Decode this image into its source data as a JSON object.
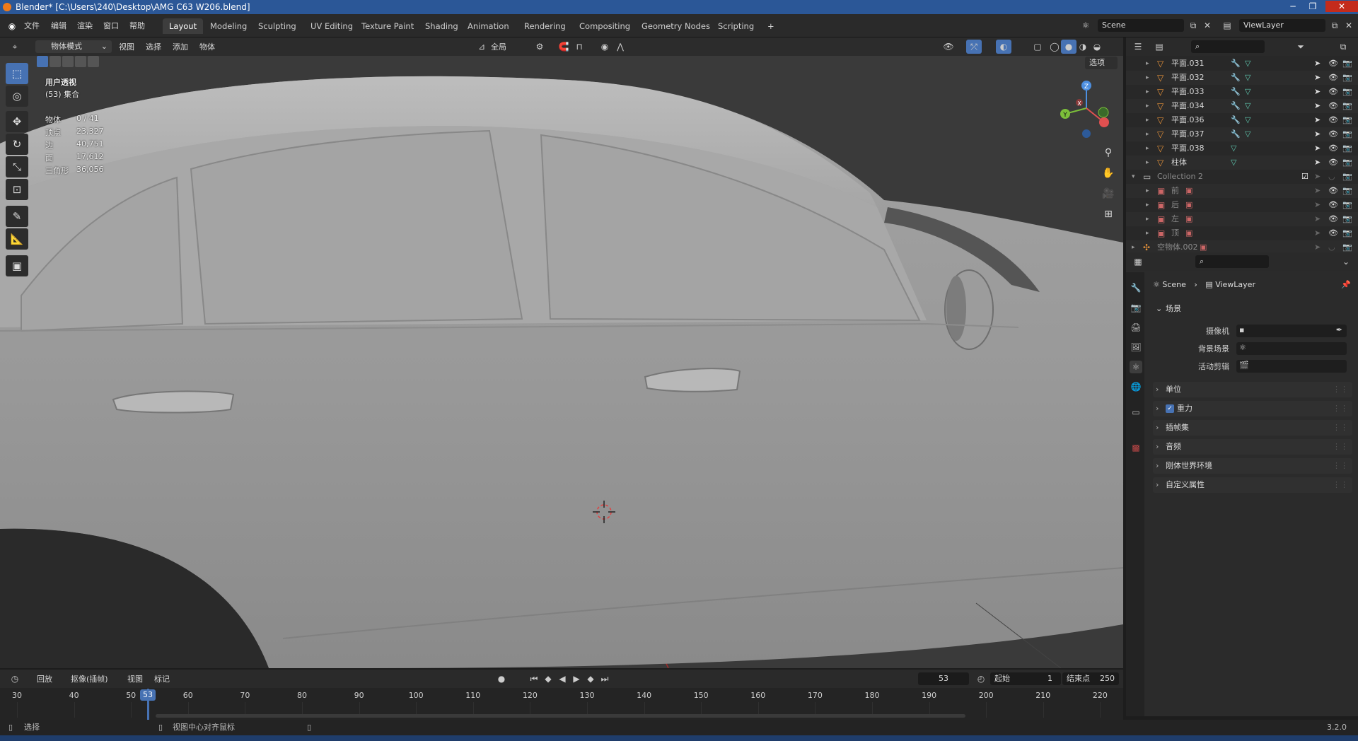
{
  "window": {
    "title": "Blender* [C:\\Users\\240\\Desktop\\AMG C63 W206.blend]",
    "minimize": "─",
    "maximize": "❐",
    "close": "✕"
  },
  "menu": {
    "file": "文件",
    "edit": "编辑",
    "render": "渲染",
    "window": "窗口",
    "help": "帮助"
  },
  "workspaces": [
    {
      "label": "Layout",
      "active": true
    },
    {
      "label": "Modeling"
    },
    {
      "label": "Sculpting"
    },
    {
      "label": "UV Editing"
    },
    {
      "label": "Texture Paint"
    },
    {
      "label": "Shading"
    },
    {
      "label": "Animation"
    },
    {
      "label": "Rendering"
    },
    {
      "label": "Compositing"
    },
    {
      "label": "Geometry Nodes"
    },
    {
      "label": "Scripting"
    },
    {
      "label": "+"
    }
  ],
  "scene": {
    "name": "Scene",
    "view_layer": "ViewLayer"
  },
  "viewport_header": {
    "mode": "物体模式",
    "view": "视图",
    "select": "选择",
    "add": "添加",
    "object": "物体",
    "transform_orientation": "全局",
    "options": "选项"
  },
  "overlay_text": {
    "view_name": "用户透视",
    "collection": "(53) 集合"
  },
  "stats": [
    {
      "label": "物体",
      "value": "0 / 41"
    },
    {
      "label": "顶点",
      "value": "23,327"
    },
    {
      "label": "边",
      "value": "40,751"
    },
    {
      "label": "面",
      "value": "17,612"
    },
    {
      "label": "三角形",
      "value": "36,056"
    }
  ],
  "gizmo": {
    "x": "X",
    "y": "Y",
    "z": "Z"
  },
  "outliner": {
    "rows": [
      {
        "name": "平面.031",
        "type": "mesh",
        "modifier": true,
        "indent": 1
      },
      {
        "name": "平面.032",
        "type": "mesh",
        "modifier": true,
        "indent": 1
      },
      {
        "name": "平面.033",
        "type": "mesh",
        "modifier": true,
        "indent": 1
      },
      {
        "name": "平面.034",
        "type": "mesh",
        "modifier": true,
        "indent": 1
      },
      {
        "name": "平面.036",
        "type": "mesh",
        "modifier": true,
        "indent": 1
      },
      {
        "name": "平面.037",
        "type": "mesh",
        "modifier": true,
        "indent": 1
      },
      {
        "name": "平面.038",
        "type": "mesh",
        "modifier": false,
        "indent": 1
      },
      {
        "name": "柱体",
        "type": "mesh",
        "modifier": false,
        "indent": 1
      },
      {
        "name": "Collection 2",
        "type": "collection",
        "indent": 0
      },
      {
        "name": "前",
        "type": "image",
        "indent": 1
      },
      {
        "name": "后",
        "type": "image",
        "indent": 1
      },
      {
        "name": "左",
        "type": "image",
        "indent": 1
      },
      {
        "name": "顶",
        "type": "image",
        "indent": 1
      },
      {
        "name": "空物体.002",
        "type": "empty",
        "indent": 0
      }
    ]
  },
  "properties": {
    "breadcrumb_scene": "Scene",
    "breadcrumb_layer": "ViewLayer",
    "scene_panel": "场景",
    "camera_label": "摄像机",
    "background_label": "背景场景",
    "clip_label": "活动剪辑",
    "panels": [
      {
        "label": "单位",
        "checkbox": false
      },
      {
        "label": "重力",
        "checkbox": true
      },
      {
        "label": "插帧集",
        "checkbox": false
      },
      {
        "label": "音频",
        "checkbox": false
      },
      {
        "label": "刚体世界环境",
        "checkbox": false
      },
      {
        "label": "自定义属性",
        "checkbox": false
      }
    ]
  },
  "timeline": {
    "playback": "回放",
    "keying": "抠像(插帧)",
    "view": "视图",
    "marker": "标记",
    "current_frame": "53",
    "start_label": "起始",
    "start": "1",
    "end_label": "结束点",
    "end": "250",
    "ticks": [
      "30",
      "40",
      "50",
      "60",
      "70",
      "80",
      "90",
      "100",
      "110",
      "120",
      "130",
      "140",
      "150",
      "160",
      "170",
      "180",
      "190",
      "200",
      "210",
      "220"
    ]
  },
  "statusbar": {
    "left": "选择",
    "middle": "视图中心对齐鼠标",
    "version": "3.2.0"
  },
  "colors": {
    "accent": "#4772b3",
    "mesh_icon": "#e8933a",
    "data_icon": "#5fc9b0",
    "modifier_icon": "#6ea2e0"
  }
}
